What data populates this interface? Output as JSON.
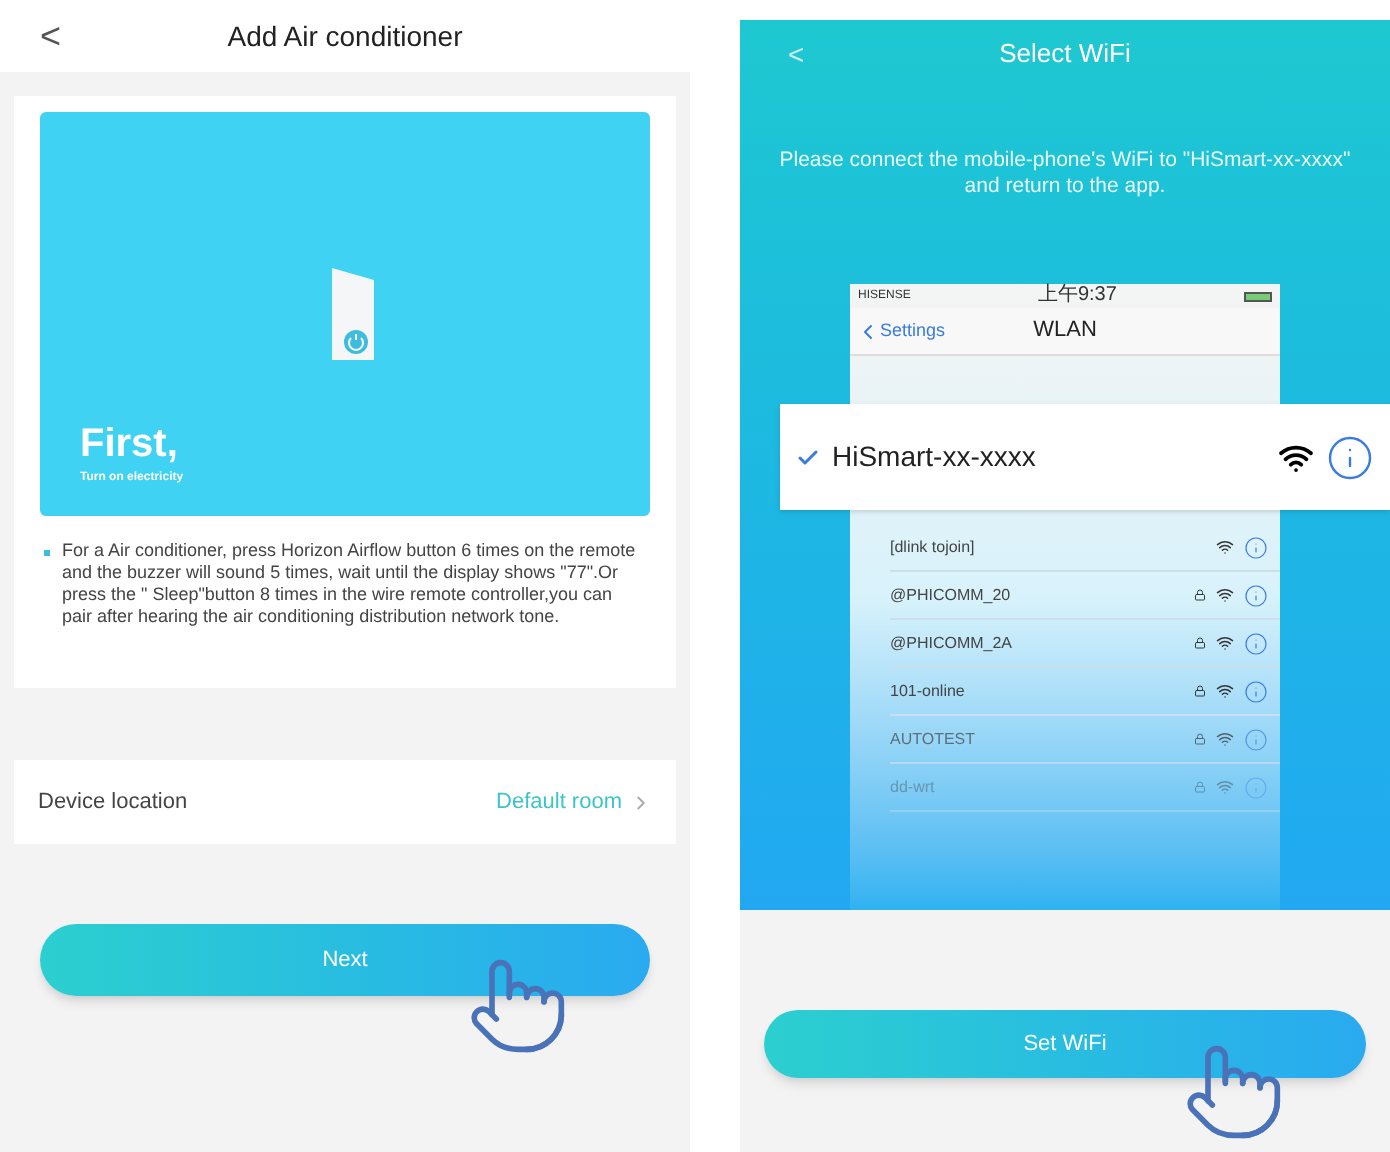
{
  "left_screen": {
    "back": "<",
    "title": "Add Air conditioner",
    "hero": {
      "heading": "First,",
      "subheading": "Turn on electricity"
    },
    "instruction": "For a Air conditioner, press Horizon Airflow button 6 times on the remote and the buzzer will sound 5 times, wait until the display shows \"77\".Or  press the \" Sleep\"button 8 times in the wire remote controller,you can pair after hearing the air conditioning distribution network tone.",
    "location": {
      "label": "Device location",
      "value": "Default room"
    },
    "button": "Next"
  },
  "right_screen": {
    "back": "<",
    "title": "Select WiFi",
    "message": "Please connect the mobile-phone's WiFi to \"HiSmart-xx-xxxx\" and return to the app.",
    "phone": {
      "carrier": "HISENSE",
      "time": "上午9:37",
      "back": "Settings",
      "title": "WLAN",
      "connected": {
        "name": "HiSmart-xx-xxxx",
        "selected": true
      },
      "networks": [
        {
          "name": "[dlink tojoin]",
          "locked": false
        },
        {
          "name": "@PHICOMM_20",
          "locked": true
        },
        {
          "name": "@PHICOMM_2A",
          "locked": true
        },
        {
          "name": "101-online",
          "locked": true
        },
        {
          "name": "AUTOTEST",
          "locked": true
        },
        {
          "name": "dd-wrt",
          "locked": true
        }
      ]
    },
    "button": "Set WiFi"
  }
}
